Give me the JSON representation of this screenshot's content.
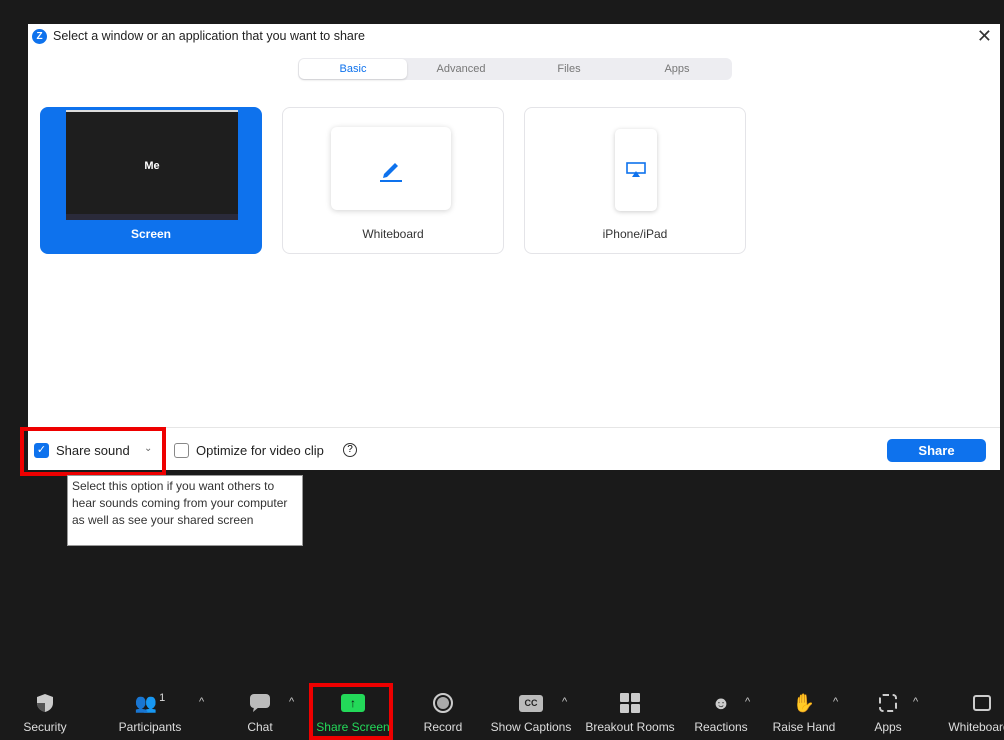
{
  "dialog": {
    "title": "Select a window or an application that you want to share",
    "tabs": [
      "Basic",
      "Advanced",
      "Files",
      "Apps"
    ],
    "cards": {
      "screen": "Screen",
      "screen_thumb_text": "Me",
      "whiteboard": "Whiteboard",
      "iphone": "iPhone/iPad"
    },
    "footer": {
      "share_sound": "Share sound",
      "share_sound_checked": true,
      "optimize": "Optimize for video clip",
      "optimize_checked": false,
      "share_button": "Share"
    },
    "tooltip": "Select this option if you want others to hear sounds coming from your computer as well as see your shared screen"
  },
  "toolbar": {
    "security": "Security",
    "participants": "Participants",
    "participants_count": "1",
    "chat": "Chat",
    "share_screen": "Share Screen",
    "record": "Record",
    "captions": "Show Captions",
    "captions_icon": "CC",
    "breakout": "Breakout Rooms",
    "reactions": "Reactions",
    "raise_hand": "Raise Hand",
    "apps": "Apps",
    "whiteboards": "Whiteboards"
  },
  "colors": {
    "accent": "#0e72ed",
    "share_green": "#23d959",
    "highlight": "#e00000"
  }
}
